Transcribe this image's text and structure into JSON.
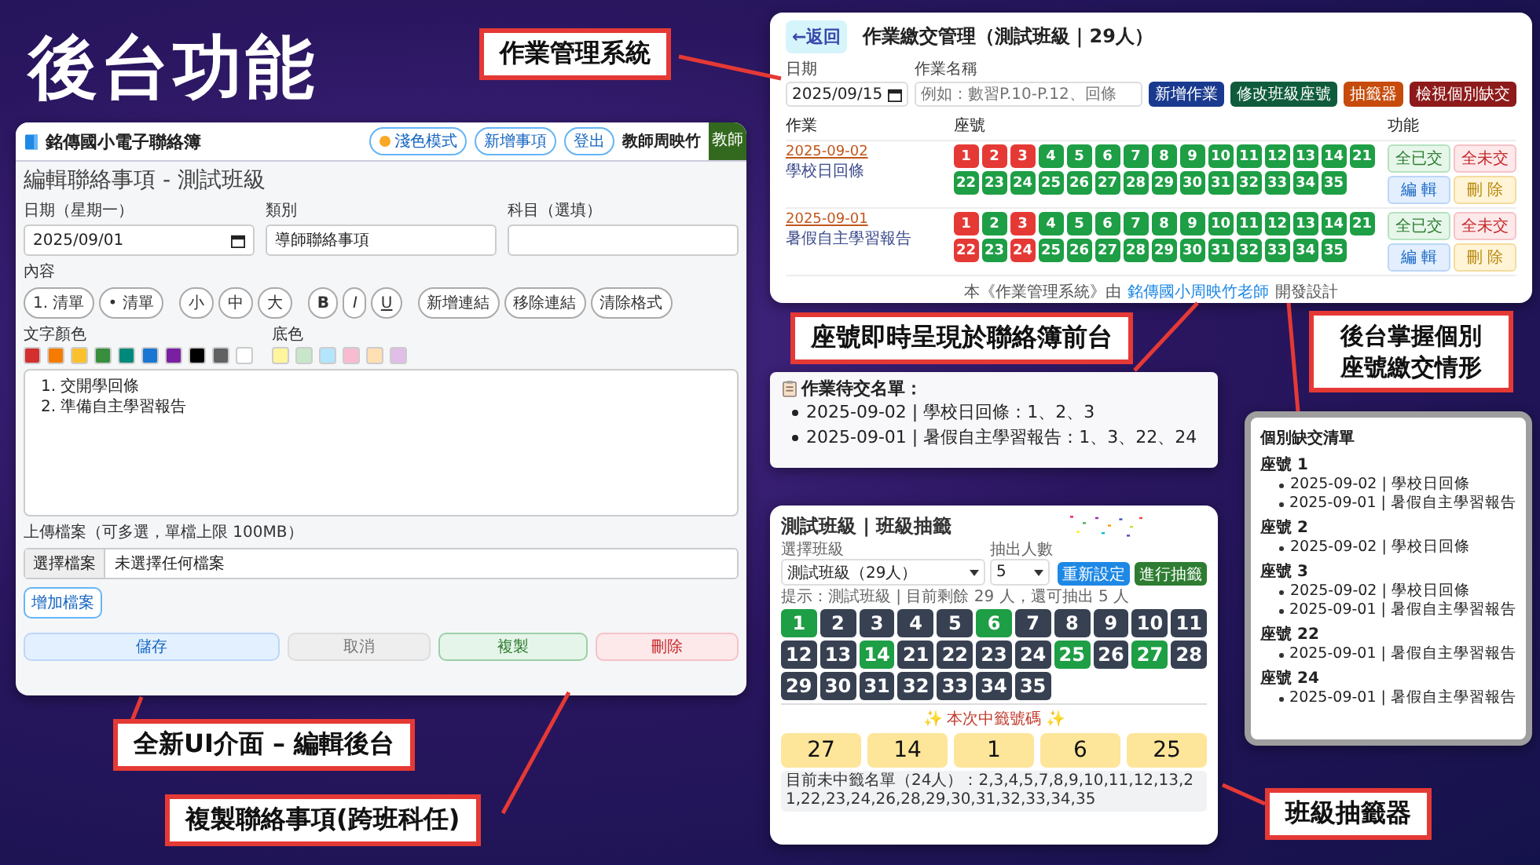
{
  "slide_title": "後台功能",
  "callouts": [
    {
      "text": "作業管理系統"
    },
    {
      "text": "座號即時呈現於聯絡簿前台"
    },
    {
      "text": "後台掌握個別座號繳交情形"
    },
    {
      "text": "全新UI介面 – 編輯後台"
    },
    {
      "text": "複製聯絡事項(跨班科任)"
    },
    {
      "text": "班級抽籤器"
    }
  ],
  "editor": {
    "app_name": "銘傳國小電子聯絡簿",
    "header_buttons": [
      "淺色模式",
      "新增事項",
      "登出"
    ],
    "user": "教師周映竹",
    "avatar": "教師",
    "heading": "編輯聯絡事項 - 測試班級",
    "fields": [
      {
        "label": "日期（星期一）",
        "value": "2025/09/01",
        "kind": "date"
      },
      {
        "label": "類別",
        "value": "導師聯絡事項",
        "kind": "text"
      },
      {
        "label": "科目（選填）",
        "kind": "text"
      }
    ],
    "content_label": "內容",
    "toolbar": [
      [
        {
          "label": "1. 清單",
          "kind": "plain"
        },
        {
          "label": "• 清單",
          "kind": "plain"
        }
      ],
      [
        {
          "label": "小",
          "kind": "plain"
        },
        {
          "label": "中",
          "kind": "plain"
        },
        {
          "label": "大",
          "kind": "plain"
        }
      ],
      [
        {
          "label": "B",
          "kind": "bold"
        },
        {
          "label": "I",
          "kind": "italic"
        },
        {
          "label": "U",
          "kind": "underline"
        }
      ],
      [
        {
          "label": "新增連結",
          "kind": "plain"
        },
        {
          "label": "移除連結",
          "kind": "plain"
        },
        {
          "label": "清除格式",
          "kind": "plain"
        }
      ]
    ],
    "text_color_label": "文字顏色",
    "text_colors": [
      {
        "color": "#d32f2f"
      },
      {
        "color": "#f57c00"
      },
      {
        "color": "#fbc02d"
      },
      {
        "color": "#388e3c"
      },
      {
        "color": "#00897b"
      },
      {
        "color": "#1976d2"
      },
      {
        "color": "#7b1fa2"
      },
      {
        "color": "#000000"
      },
      {
        "color": "#616161"
      },
      {
        "color": "#ffffff"
      }
    ],
    "bg_color_label": "底色",
    "bg_colors": [
      {
        "color": "#fff59d"
      },
      {
        "color": "#c8e6c9"
      },
      {
        "color": "#b3e5fc"
      },
      {
        "color": "#f8bbd0"
      },
      {
        "color": "#ffe0b2"
      },
      {
        "color": "#e1bee7"
      }
    ],
    "content_lines": [
      "1. 交開學回條",
      "2. 準備自主學習報告"
    ],
    "upload_label": "上傳檔案（可多選，單檔上限 100MB）",
    "file_button": "選擇檔案",
    "file_status": "未選擇任何檔案",
    "add_file": "增加檔案",
    "actions": [
      {
        "label": "儲存",
        "kind": "primary"
      },
      {
        "label": "取消",
        "kind": "secondary"
      },
      {
        "label": "複製",
        "kind": "success"
      },
      {
        "label": "刪除",
        "kind": "danger"
      }
    ]
  },
  "homework": {
    "back": "←返回",
    "title": "作業繳交管理（測試班級｜29人）",
    "date_label": "日期",
    "date_value": "2025/09/15",
    "name_label": "作業名稱",
    "name_placeholder": "例如：數習P.10-P.12、回條",
    "buttons": [
      {
        "label": "新增作業",
        "kind": "navy"
      },
      {
        "label": "修改班級座號",
        "kind": "teal"
      },
      {
        "label": "抽籤器",
        "kind": "orange"
      },
      {
        "label": "檢視個別缺交",
        "kind": "maroon"
      }
    ],
    "columns": [
      "作業",
      "座號",
      "功能"
    ],
    "rows": [
      {
        "date": "2025-09-02",
        "name": "學校日回條",
        "seats": [
          {
            "no": "1",
            "submitted": false
          },
          {
            "no": "2",
            "submitted": false
          },
          {
            "no": "3",
            "submitted": false
          },
          {
            "no": "4",
            "submitted": true
          },
          {
            "no": "5",
            "submitted": true
          },
          {
            "no": "6",
            "submitted": true
          },
          {
            "no": "7",
            "submitted": true
          },
          {
            "no": "8",
            "submitted": true
          },
          {
            "no": "9",
            "submitted": true
          },
          {
            "no": "10",
            "submitted": true
          },
          {
            "no": "11",
            "submitted": true
          },
          {
            "no": "12",
            "submitted": true
          },
          {
            "no": "13",
            "submitted": true
          },
          {
            "no": "14",
            "submitted": true
          },
          {
            "no": "21",
            "submitted": true
          },
          {
            "no": "22",
            "submitted": true
          },
          {
            "no": "23",
            "submitted": true
          },
          {
            "no": "24",
            "submitted": true
          },
          {
            "no": "25",
            "submitted": true
          },
          {
            "no": "26",
            "submitted": true
          },
          {
            "no": "27",
            "submitted": true
          },
          {
            "no": "28",
            "submitted": true
          },
          {
            "no": "29",
            "submitted": true
          },
          {
            "no": "30",
            "submitted": true
          },
          {
            "no": "31",
            "submitted": true
          },
          {
            "no": "32",
            "submitted": true
          },
          {
            "no": "33",
            "submitted": true
          },
          {
            "no": "34",
            "submitted": true
          },
          {
            "no": "35",
            "submitted": true
          }
        ],
        "actions": [
          {
            "label": "全已交",
            "kind": "green"
          },
          {
            "label": "全未交",
            "kind": "red"
          },
          {
            "label": "編 輯",
            "kind": "blue"
          },
          {
            "label": "刪 除",
            "kind": "yellow"
          }
        ]
      },
      {
        "date": "2025-09-01",
        "name": "暑假自主學習報告",
        "seats": [
          {
            "no": "1",
            "submitted": false
          },
          {
            "no": "2",
            "submitted": true
          },
          {
            "no": "3",
            "submitted": false
          },
          {
            "no": "4",
            "submitted": true
          },
          {
            "no": "5",
            "submitted": true
          },
          {
            "no": "6",
            "submitted": true
          },
          {
            "no": "7",
            "submitted": true
          },
          {
            "no": "8",
            "submitted": true
          },
          {
            "no": "9",
            "submitted": true
          },
          {
            "no": "10",
            "submitted": true
          },
          {
            "no": "11",
            "submitted": true
          },
          {
            "no": "12",
            "submitted": true
          },
          {
            "no": "13",
            "submitted": true
          },
          {
            "no": "14",
            "submitted": true
          },
          {
            "no": "21",
            "submitted": true
          },
          {
            "no": "22",
            "submitted": false
          },
          {
            "no": "23",
            "submitted": true
          },
          {
            "no": "24",
            "submitted": false
          },
          {
            "no": "25",
            "submitted": true
          },
          {
            "no": "26",
            "submitted": true
          },
          {
            "no": "27",
            "submitted": true
          },
          {
            "no": "28",
            "submitted": true
          },
          {
            "no": "29",
            "submitted": true
          },
          {
            "no": "30",
            "submitted": true
          },
          {
            "no": "31",
            "submitted": true
          },
          {
            "no": "32",
            "submitted": true
          },
          {
            "no": "33",
            "submitted": true
          },
          {
            "no": "34",
            "submitted": true
          },
          {
            "no": "35",
            "submitted": true
          }
        ],
        "actions": [
          {
            "label": "全已交",
            "kind": "green"
          },
          {
            "label": "全未交",
            "kind": "red"
          },
          {
            "label": "編 輯",
            "kind": "blue"
          },
          {
            "label": "刪 除",
            "kind": "yellow"
          }
        ]
      }
    ],
    "footer_before": "本《作業管理系統》由",
    "footer_link": "銘傳國小周映竹老師",
    "footer_after": "開發設計"
  },
  "pending": {
    "title": "作業待交名單：",
    "items": [
      "2025-09-02 | 學校日回條：1、2、3",
      "2025-09-01 | 暑假自主學習報告：1、3、22、24"
    ]
  },
  "lottery": {
    "title": "測試班級 | 班級抽籤",
    "class_label": "選擇班級",
    "class_value": "測試班級（29人）",
    "count_label": "抽出人數",
    "count_value": "5",
    "buttons": [
      {
        "label": "重新設定",
        "kind": "blue"
      },
      {
        "label": "進行抽籤",
        "kind": "green"
      }
    ],
    "hint": "提示：測試班級 | 目前剩餘 29 人，還可抽出 5 人",
    "seats": [
      {
        "no": "1",
        "selected": true
      },
      {
        "no": "2",
        "selected": false
      },
      {
        "no": "3",
        "selected": false
      },
      {
        "no": "4",
        "selected": false
      },
      {
        "no": "5",
        "selected": false
      },
      {
        "no": "6",
        "selected": true
      },
      {
        "no": "7",
        "selected": false
      },
      {
        "no": "8",
        "selected": false
      },
      {
        "no": "9",
        "selected": false
      },
      {
        "no": "10",
        "selected": false
      },
      {
        "no": "11",
        "selected": false
      },
      {
        "no": "12",
        "selected": false
      },
      {
        "no": "13",
        "selected": false
      },
      {
        "no": "14",
        "selected": true
      },
      {
        "no": "21",
        "selected": false
      },
      {
        "no": "22",
        "selected": false
      },
      {
        "no": "23",
        "selected": false
      },
      {
        "no": "24",
        "selected": false
      },
      {
        "no": "25",
        "selected": true
      },
      {
        "no": "26",
        "selected": false
      },
      {
        "no": "27",
        "selected": true
      },
      {
        "no": "28",
        "selected": false
      },
      {
        "no": "29",
        "selected": false
      },
      {
        "no": "30",
        "selected": false
      },
      {
        "no": "31",
        "selected": false
      },
      {
        "no": "32",
        "selected": false
      },
      {
        "no": "33",
        "selected": false
      },
      {
        "no": "34",
        "selected": false
      },
      {
        "no": "35",
        "selected": false
      }
    ],
    "result_heading": "✨ 本次中籤號碼 ✨",
    "results": [
      "27",
      "14",
      "1",
      "6",
      "25"
    ],
    "remaining": "目前未中籤名單（24人）：2,3,4,5,7,8,9,10,11,12,13,21,22,23,24,26,28,29,30,31,32,33,34,35"
  },
  "missing": {
    "title": "個別缺交清單",
    "groups": [
      {
        "seat": "座號 1",
        "items": [
          "2025-09-02 | 學校日回條",
          "2025-09-01 | 暑假自主學習報告"
        ]
      },
      {
        "seat": "座號 2",
        "items": [
          "2025-09-02 | 學校日回條"
        ]
      },
      {
        "seat": "座號 3",
        "items": [
          "2025-09-02 | 學校日回條",
          "2025-09-01 | 暑假自主學習報告"
        ]
      },
      {
        "seat": "座號 22",
        "items": [
          "2025-09-01 | 暑假自主學習報告"
        ]
      },
      {
        "seat": "座號 24",
        "items": [
          "2025-09-01 | 暑假自主學習報告"
        ]
      }
    ]
  }
}
